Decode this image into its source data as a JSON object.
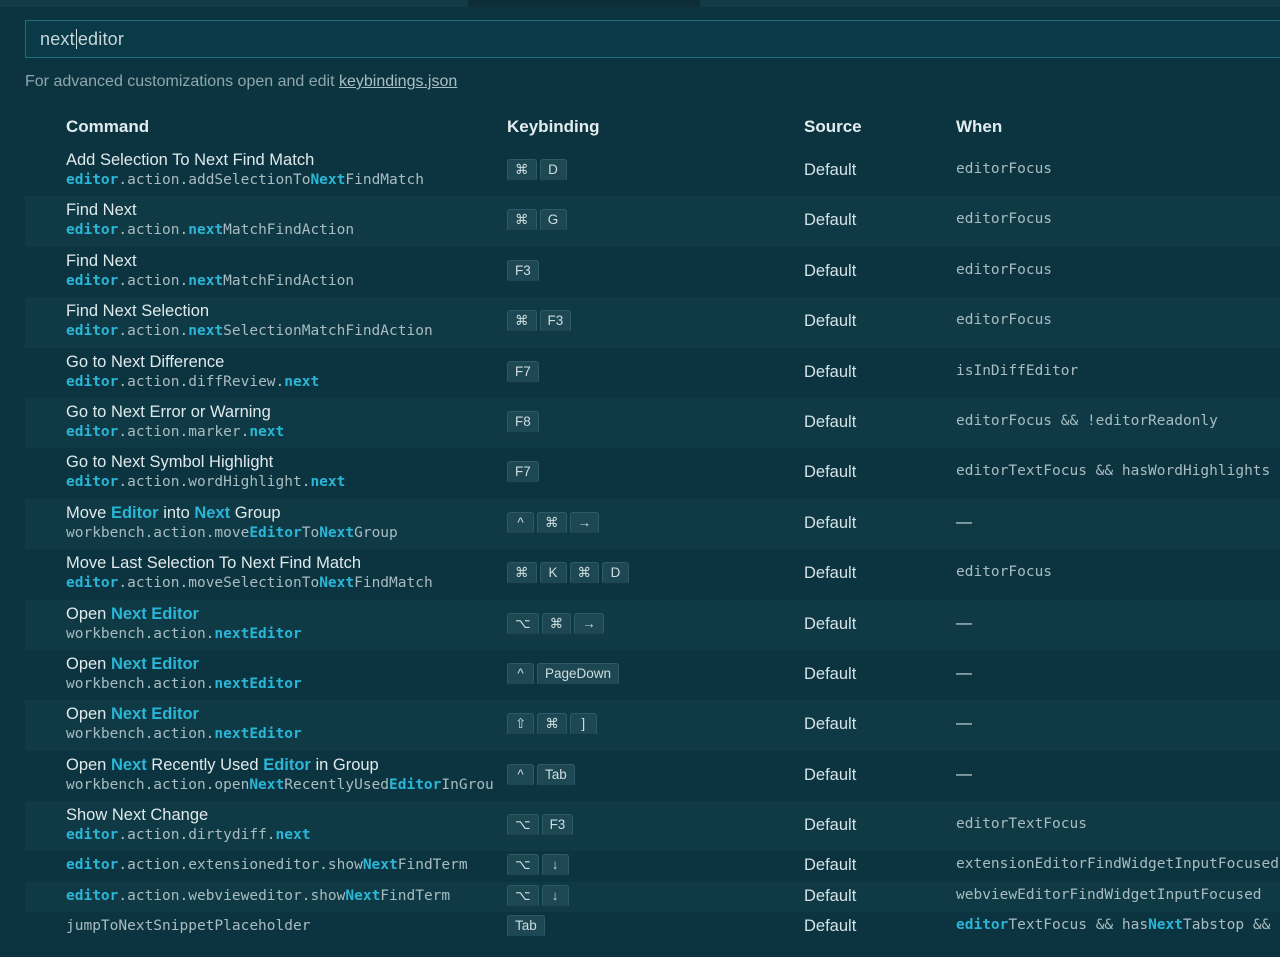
{
  "search": {
    "value_before_caret": "next ",
    "value_after_caret": "editor"
  },
  "hint": {
    "text": "For advanced customizations open and edit ",
    "link": "keybindings.json"
  },
  "columns": {
    "command": "Command",
    "keybinding": "Keybinding",
    "source": "Source",
    "when": "When"
  },
  "rows": [
    {
      "title": [
        [
          "Add Selection To Next Find Match",
          false
        ]
      ],
      "id": [
        [
          "editor",
          true
        ],
        [
          ".action.addSelectionTo",
          false
        ],
        [
          "Next",
          true
        ],
        [
          "FindMatch",
          false
        ]
      ],
      "keys": [
        "⌘",
        "D"
      ],
      "source": "Default",
      "when": [
        [
          "editorFocus",
          false
        ]
      ]
    },
    {
      "title": [
        [
          "Find Next",
          false
        ]
      ],
      "id": [
        [
          "editor",
          true
        ],
        [
          ".action.",
          false
        ],
        [
          "next",
          true
        ],
        [
          "MatchFindAction",
          false
        ]
      ],
      "keys": [
        "⌘",
        "G"
      ],
      "source": "Default",
      "when": [
        [
          "editorFocus",
          false
        ]
      ]
    },
    {
      "title": [
        [
          "Find Next",
          false
        ]
      ],
      "id": [
        [
          "editor",
          true
        ],
        [
          ".action.",
          false
        ],
        [
          "next",
          true
        ],
        [
          "MatchFindAction",
          false
        ]
      ],
      "keys": [
        "F3"
      ],
      "source": "Default",
      "when": [
        [
          "editorFocus",
          false
        ]
      ]
    },
    {
      "title": [
        [
          "Find Next Selection",
          false
        ]
      ],
      "id": [
        [
          "editor",
          true
        ],
        [
          ".action.",
          false
        ],
        [
          "next",
          true
        ],
        [
          "SelectionMatchFindAction",
          false
        ]
      ],
      "keys": [
        "⌘",
        "F3"
      ],
      "source": "Default",
      "when": [
        [
          "editorFocus",
          false
        ]
      ]
    },
    {
      "title": [
        [
          "Go to Next Difference",
          false
        ]
      ],
      "id": [
        [
          "editor",
          true
        ],
        [
          ".action.diffReview.",
          false
        ],
        [
          "next",
          true
        ]
      ],
      "keys": [
        "F7"
      ],
      "source": "Default",
      "when": [
        [
          "isInDiffEditor",
          false
        ]
      ]
    },
    {
      "title": [
        [
          "Go to Next Error or Warning",
          false
        ]
      ],
      "id": [
        [
          "editor",
          true
        ],
        [
          ".action.marker.",
          false
        ],
        [
          "next",
          true
        ]
      ],
      "keys": [
        "F8"
      ],
      "source": "Default",
      "when": [
        [
          "editorFocus && !editorReadonly",
          false
        ]
      ]
    },
    {
      "title": [
        [
          "Go to Next Symbol Highlight",
          false
        ]
      ],
      "id": [
        [
          "editor",
          true
        ],
        [
          ".action.wordHighlight.",
          false
        ],
        [
          "next",
          true
        ]
      ],
      "keys": [
        "F7"
      ],
      "source": "Default",
      "when": [
        [
          "editorTextFocus && hasWordHighlights",
          false
        ]
      ]
    },
    {
      "title": [
        [
          "Move ",
          false
        ],
        [
          "Editor",
          true
        ],
        [
          " into ",
          false
        ],
        [
          "Next",
          true
        ],
        [
          " Group",
          false
        ]
      ],
      "id": [
        [
          "workbench.action.move",
          false
        ],
        [
          "Editor",
          true
        ],
        [
          "To",
          false
        ],
        [
          "Next",
          true
        ],
        [
          "Group",
          false
        ]
      ],
      "keys": [
        "^",
        "⌘",
        "→"
      ],
      "source": "Default",
      "when": [
        [
          "—",
          false
        ]
      ],
      "dash": true
    },
    {
      "title": [
        [
          "Move Last Selection To Next Find Match",
          false
        ]
      ],
      "id": [
        [
          "editor",
          true
        ],
        [
          ".action.moveSelectionTo",
          false
        ],
        [
          "Next",
          true
        ],
        [
          "FindMatch",
          false
        ]
      ],
      "keys": [
        "⌘",
        "K",
        "⌘",
        "D"
      ],
      "source": "Default",
      "when": [
        [
          "editorFocus",
          false
        ]
      ]
    },
    {
      "title": [
        [
          "Open ",
          false
        ],
        [
          "Next Editor",
          true
        ]
      ],
      "id": [
        [
          "workbench.action.",
          false
        ],
        [
          "nextEditor",
          true
        ]
      ],
      "keys": [
        "⌥",
        "⌘",
        "→"
      ],
      "source": "Default",
      "when": [
        [
          "—",
          false
        ]
      ],
      "dash": true
    },
    {
      "title": [
        [
          "Open ",
          false
        ],
        [
          "Next Editor",
          true
        ]
      ],
      "id": [
        [
          "workbench.action.",
          false
        ],
        [
          "nextEditor",
          true
        ]
      ],
      "keys": [
        "^",
        "PageDown"
      ],
      "source": "Default",
      "when": [
        [
          "—",
          false
        ]
      ],
      "dash": true
    },
    {
      "title": [
        [
          "Open ",
          false
        ],
        [
          "Next Editor",
          true
        ]
      ],
      "id": [
        [
          "workbench.action.",
          false
        ],
        [
          "nextEditor",
          true
        ]
      ],
      "keys": [
        "⇧",
        "⌘",
        "]"
      ],
      "source": "Default",
      "when": [
        [
          "—",
          false
        ]
      ],
      "dash": true
    },
    {
      "title": [
        [
          "Open ",
          false
        ],
        [
          "Next",
          true
        ],
        [
          " Recently Used ",
          false
        ],
        [
          "Editor",
          true
        ],
        [
          " in Group",
          false
        ]
      ],
      "id": [
        [
          "workbench.action.open",
          false
        ],
        [
          "Next",
          true
        ],
        [
          "RecentlyUsed",
          false
        ],
        [
          "Editor",
          true
        ],
        [
          "InGrou",
          false
        ]
      ],
      "keys": [
        "^",
        "Tab"
      ],
      "source": "Default",
      "when": [
        [
          "—",
          false
        ]
      ],
      "dash": true
    },
    {
      "title": [
        [
          "Show Next Change",
          false
        ]
      ],
      "id": [
        [
          "editor",
          true
        ],
        [
          ".action.dirtydiff.",
          false
        ],
        [
          "next",
          true
        ]
      ],
      "keys": [
        "⌥",
        "F3"
      ],
      "source": "Default",
      "when": [
        [
          "editorTextFocus",
          false
        ]
      ]
    },
    {
      "single": true,
      "id": [
        [
          "editor",
          true
        ],
        [
          ".action.extensioneditor.show",
          false
        ],
        [
          "Next",
          true
        ],
        [
          "FindTerm",
          false
        ]
      ],
      "keys": [
        "⌥",
        "↓"
      ],
      "source": "Default",
      "when": [
        [
          "extensionEditorFindWidgetInputFocused",
          false
        ]
      ]
    },
    {
      "single": true,
      "id": [
        [
          "editor",
          true
        ],
        [
          ".action.webvieweditor.show",
          false
        ],
        [
          "Next",
          true
        ],
        [
          "FindTerm",
          false
        ]
      ],
      "keys": [
        "⌥",
        "↓"
      ],
      "source": "Default",
      "when": [
        [
          "webviewEditorFindWidgetInputFocused",
          false
        ]
      ]
    },
    {
      "single": true,
      "id": [
        [
          "jumpToNextSnippetPlaceholder",
          false
        ]
      ],
      "keys": [
        "Tab"
      ],
      "source": "Default",
      "when": [
        [
          "editor",
          true
        ],
        [
          "TextFocus && has",
          false
        ],
        [
          "Next",
          true
        ],
        [
          "Tabstop &&",
          false
        ]
      ]
    }
  ],
  "colors": {
    "background": "#0b3440",
    "highlight": "#2ab6d6",
    "row_alt": "#0e3945"
  }
}
